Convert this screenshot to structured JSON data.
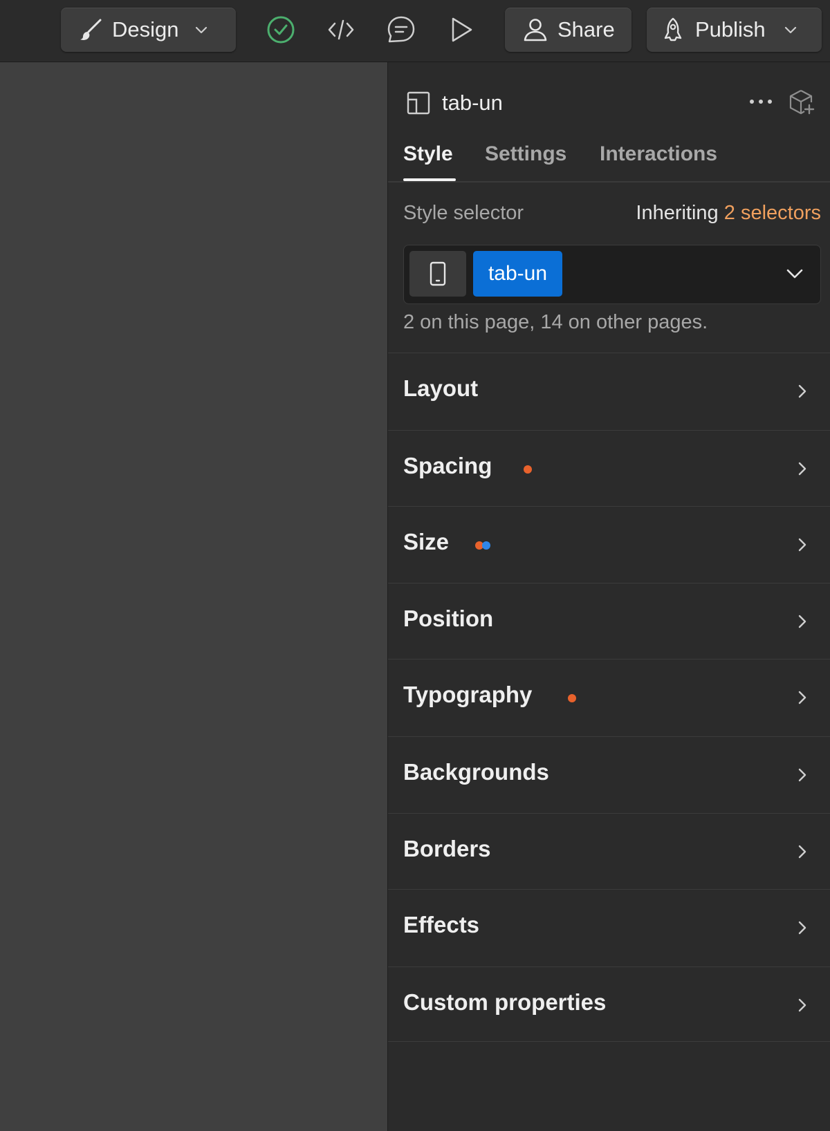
{
  "toolbar": {
    "design_label": "Design",
    "share_label": "Share",
    "publish_label": "Publish",
    "icons": [
      "paintbrush-icon",
      "check-circle-icon",
      "code-icon",
      "comment-icon",
      "play-icon",
      "user-icon",
      "rocket-icon"
    ],
    "check_color": "#4caf6e"
  },
  "panel": {
    "element_name": "tab-un",
    "tabs": [
      {
        "label": "Style",
        "active": true
      },
      {
        "label": "Settings",
        "active": false
      },
      {
        "label": "Interactions",
        "active": false
      }
    ],
    "selector": {
      "label": "Style selector",
      "inheriting_prefix": "Inheriting",
      "inheriting_count": "2 selectors",
      "class_name": "tab-un",
      "usage_note": "2 on this page, 14 on other pages."
    },
    "sections": [
      {
        "name": "Layout",
        "indicators": []
      },
      {
        "name": "Spacing",
        "indicators": [
          "#e8622c"
        ]
      },
      {
        "name": "Size",
        "indicators": [
          "#e8622c",
          "#2f86e8"
        ]
      },
      {
        "name": "Position",
        "indicators": []
      },
      {
        "name": "Typography",
        "indicators": [
          "#e8622c"
        ]
      },
      {
        "name": "Backgrounds",
        "indicators": []
      },
      {
        "name": "Borders",
        "indicators": []
      },
      {
        "name": "Effects",
        "indicators": []
      },
      {
        "name": "Custom properties",
        "indicators": []
      }
    ]
  },
  "colors": {
    "accent_orange": "#f0a05e",
    "class_chip_blue": "#0b6fd6",
    "modified_orange": "#e8622c",
    "inherited_blue": "#2f86e8"
  }
}
